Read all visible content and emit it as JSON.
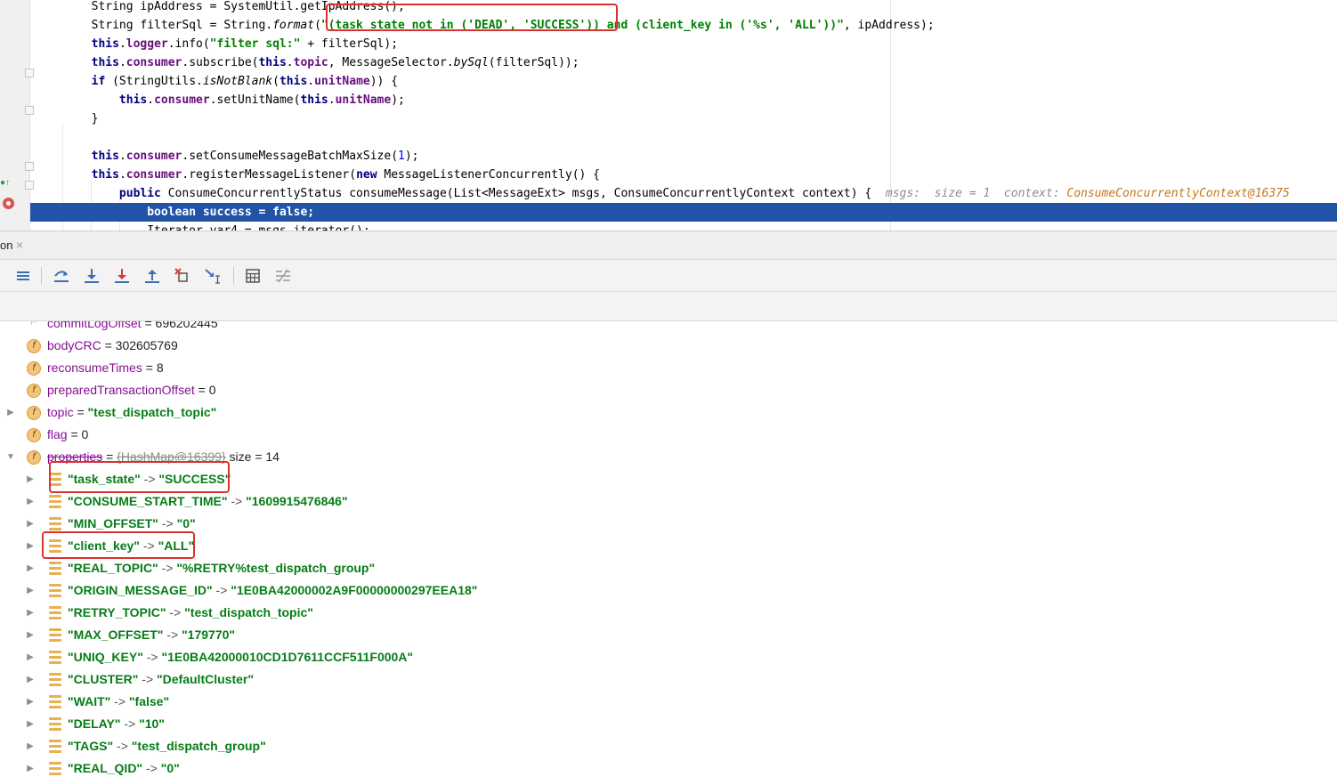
{
  "editor": {
    "lines": [
      {
        "segments": [
          {
            "t": "        String ipAddress = SystemUtil.getIpAddress();",
            "c": ""
          }
        ]
      },
      {
        "segments": [
          {
            "t": "        String filterSql = String.",
            "c": ""
          },
          {
            "t": "format",
            "c": "itl"
          },
          {
            "t": "(",
            "c": ""
          },
          {
            "t": "\"(task_state not in ('DEAD', 'SUCCESS')) and (client_key in ('%s', 'ALL'))\"",
            "c": "str"
          },
          {
            "t": ", ipAddress);",
            "c": ""
          }
        ]
      },
      {
        "segments": [
          {
            "t": "        ",
            "c": ""
          },
          {
            "t": "this",
            "c": "kw"
          },
          {
            "t": ".",
            "c": ""
          },
          {
            "t": "logger",
            "c": "fld"
          },
          {
            "t": ".info(",
            "c": ""
          },
          {
            "t": "\"filter sql:\"",
            "c": "str"
          },
          {
            "t": " + filterSql);",
            "c": ""
          }
        ]
      },
      {
        "segments": [
          {
            "t": "        ",
            "c": ""
          },
          {
            "t": "this",
            "c": "kw"
          },
          {
            "t": ".",
            "c": ""
          },
          {
            "t": "consumer",
            "c": "fld"
          },
          {
            "t": ".subscribe(",
            "c": ""
          },
          {
            "t": "this",
            "c": "kw"
          },
          {
            "t": ".",
            "c": ""
          },
          {
            "t": "topic",
            "c": "fld"
          },
          {
            "t": ", MessageSelector.",
            "c": ""
          },
          {
            "t": "bySql",
            "c": "itl"
          },
          {
            "t": "(filterSql));",
            "c": ""
          }
        ]
      },
      {
        "segments": [
          {
            "t": "        ",
            "c": ""
          },
          {
            "t": "if",
            "c": "kw"
          },
          {
            "t": " (StringUtils.",
            "c": ""
          },
          {
            "t": "isNotBlank",
            "c": "itl"
          },
          {
            "t": "(",
            "c": ""
          },
          {
            "t": "this",
            "c": "kw"
          },
          {
            "t": ".",
            "c": ""
          },
          {
            "t": "unitName",
            "c": "fld"
          },
          {
            "t": ")) {",
            "c": ""
          }
        ]
      },
      {
        "segments": [
          {
            "t": "            ",
            "c": ""
          },
          {
            "t": "this",
            "c": "kw"
          },
          {
            "t": ".",
            "c": ""
          },
          {
            "t": "consumer",
            "c": "fld"
          },
          {
            "t": ".setUnitName(",
            "c": ""
          },
          {
            "t": "this",
            "c": "kw"
          },
          {
            "t": ".",
            "c": ""
          },
          {
            "t": "unitName",
            "c": "fld"
          },
          {
            "t": ");",
            "c": ""
          }
        ]
      },
      {
        "segments": [
          {
            "t": "        }",
            "c": ""
          }
        ]
      },
      {
        "segments": [
          {
            "t": "",
            "c": ""
          }
        ]
      },
      {
        "segments": [
          {
            "t": "        ",
            "c": ""
          },
          {
            "t": "this",
            "c": "kw"
          },
          {
            "t": ".",
            "c": ""
          },
          {
            "t": "consumer",
            "c": "fld"
          },
          {
            "t": ".setConsumeMessageBatchMaxSize(",
            "c": ""
          },
          {
            "t": "1",
            "c": "num"
          },
          {
            "t": ");",
            "c": ""
          }
        ]
      },
      {
        "segments": [
          {
            "t": "        ",
            "c": ""
          },
          {
            "t": "this",
            "c": "kw"
          },
          {
            "t": ".",
            "c": ""
          },
          {
            "t": "consumer",
            "c": "fld"
          },
          {
            "t": ".registerMessageListener(",
            "c": ""
          },
          {
            "t": "new",
            "c": "kw"
          },
          {
            "t": " MessageListenerConcurrently() {",
            "c": ""
          }
        ]
      },
      {
        "segments": [
          {
            "t": "            ",
            "c": ""
          },
          {
            "t": "public",
            "c": "kw"
          },
          {
            "t": " ConsumeConcurrentlyStatus consumeMessage(List<MessageExt> msgs, ConsumeConcurrentlyContext context) {  ",
            "c": ""
          },
          {
            "t": "msgs:  size = 1  context: ",
            "c": "inl"
          },
          {
            "t": "ConsumeConcurrentlyContext@16375",
            "c": "inl-val"
          }
        ]
      },
      {
        "segments": [
          {
            "t": "                ",
            "c": ""
          },
          {
            "t": "boolean",
            "c": "kw"
          },
          {
            "t": " ",
            "c": ""
          },
          {
            "t": "success",
            "c": "kw"
          },
          {
            "t": " = ",
            "c": "kw"
          },
          {
            "t": "false",
            "c": "kw"
          },
          {
            "t": ";",
            "c": "kw"
          }
        ]
      },
      {
        "segments": [
          {
            "t": "                Iterator var4 = msgs.iterator();",
            "c": ""
          }
        ]
      }
    ]
  },
  "debug_tab": {
    "label": "on",
    "close": "×"
  },
  "toolbar": {
    "icons": [
      "show-execution-point-icon",
      "step-over-icon",
      "step-into-icon",
      "force-step-into-icon",
      "step-out-icon",
      "drop-frame-icon",
      "run-to-cursor-icon",
      "evaluate-expression-icon",
      "trace-icon"
    ]
  },
  "variables": {
    "rows": [
      {
        "kind": "field",
        "name": "commitLogOffset",
        "value": "696202445",
        "vtype": "num",
        "expand": "none",
        "partial": true
      },
      {
        "kind": "field",
        "name": "bodyCRC",
        "value": "302605769",
        "vtype": "num",
        "expand": "none"
      },
      {
        "kind": "field",
        "name": "reconsumeTimes",
        "value": "8",
        "vtype": "num",
        "expand": "none"
      },
      {
        "kind": "field",
        "name": "preparedTransactionOffset",
        "value": "0",
        "vtype": "num",
        "expand": "none"
      },
      {
        "kind": "field",
        "name": "topic",
        "value": "\"test_dispatch_topic\"",
        "vtype": "str",
        "expand": "collapsed"
      },
      {
        "kind": "field",
        "name": "flag",
        "value": "0",
        "vtype": "num",
        "expand": "none"
      },
      {
        "kind": "field",
        "name": "properties",
        "value": "{HashMap@16399}",
        "vtype": "ref",
        "suffix": "size = 14",
        "expand": "expanded"
      },
      {
        "kind": "entry",
        "key": "\"task_state\"",
        "value": "\"SUCCESS\""
      },
      {
        "kind": "entry",
        "key": "\"CONSUME_START_TIME\"",
        "value": "\"1609915476846\""
      },
      {
        "kind": "entry",
        "key": "\"MIN_OFFSET\"",
        "value": "\"0\""
      },
      {
        "kind": "entry",
        "key": "\"client_key\"",
        "value": "\"ALL\""
      },
      {
        "kind": "entry",
        "key": "\"REAL_TOPIC\"",
        "value": "\"%RETRY%test_dispatch_group\""
      },
      {
        "kind": "entry",
        "key": "\"ORIGIN_MESSAGE_ID\"",
        "value": "\"1E0BA42000002A9F00000000297EEA18\""
      },
      {
        "kind": "entry",
        "key": "\"RETRY_TOPIC\"",
        "value": "\"test_dispatch_topic\""
      },
      {
        "kind": "entry",
        "key": "\"MAX_OFFSET\"",
        "value": "\"179770\""
      },
      {
        "kind": "entry",
        "key": "\"UNIQ_KEY\"",
        "value": "\"1E0BA42000010CD1D7611CCF511F000A\""
      },
      {
        "kind": "entry",
        "key": "\"CLUSTER\"",
        "value": "\"DefaultCluster\""
      },
      {
        "kind": "entry",
        "key": "\"WAIT\"",
        "value": "\"false\""
      },
      {
        "kind": "entry",
        "key": "\"DELAY\"",
        "value": "\"10\""
      },
      {
        "kind": "entry",
        "key": "\"TAGS\"",
        "value": "\"test_dispatch_group\""
      },
      {
        "kind": "entry",
        "key": "\"REAL_QID\"",
        "value": "\"0\""
      }
    ],
    "arrow": " -> ",
    "equals": " = "
  }
}
